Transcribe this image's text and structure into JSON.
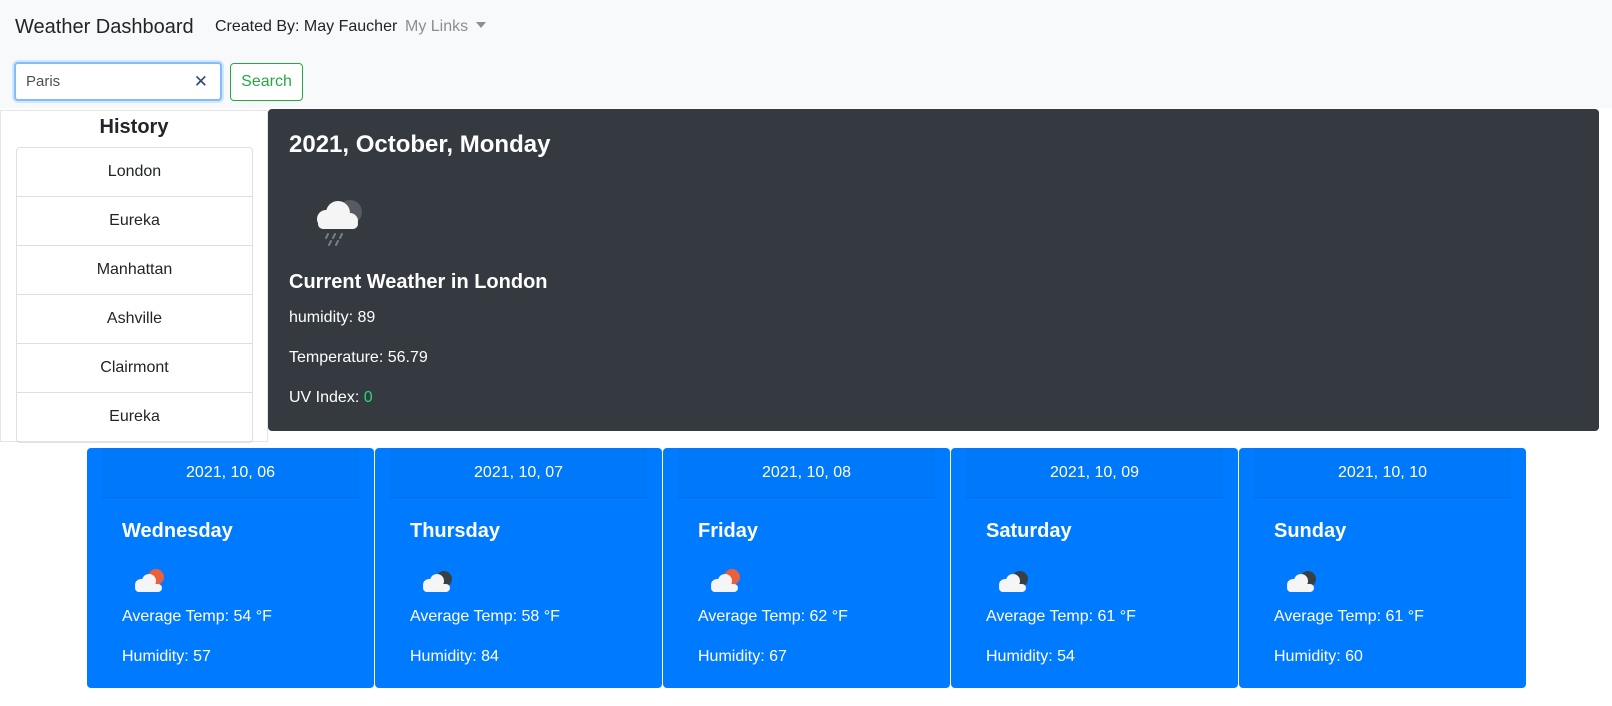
{
  "navbar": {
    "brand": "Weather Dashboard",
    "created_by": "Created By: May Faucher",
    "my_links": "My Links"
  },
  "search": {
    "value": "Paris",
    "button_label": "Search"
  },
  "history": {
    "title": "History",
    "items": [
      "London",
      "Eureka",
      "Manhattan",
      "Ashville",
      "Clairmont",
      "Eureka"
    ]
  },
  "current": {
    "date": "2021, October, Monday",
    "icon": "cloud-rain-icon",
    "heading": "Current Weather in London",
    "humidity_label": "humidity: ",
    "humidity": "89",
    "temperature_label": "Temperature: ",
    "temperature": "56.79",
    "uv_label": "UV Index: ",
    "uv": "0",
    "uv_color": "#28d77a"
  },
  "forecast": [
    {
      "date": "2021, 10, 06",
      "day": "Wednesday",
      "icon": "partly-sunny-icon",
      "temp": "Average Temp: 54 °F",
      "humidity": "Humidity: 57"
    },
    {
      "date": "2021, 10, 07",
      "day": "Thursday",
      "icon": "cloudy-icon",
      "temp": "Average Temp: 58 °F",
      "humidity": "Humidity: 84"
    },
    {
      "date": "2021, 10, 08",
      "day": "Friday",
      "icon": "partly-sunny-icon",
      "temp": "Average Temp: 62 °F",
      "humidity": "Humidity: 67"
    },
    {
      "date": "2021, 10, 09",
      "day": "Saturday",
      "icon": "cloudy-icon",
      "temp": "Average Temp: 61 °F",
      "humidity": "Humidity: 54"
    },
    {
      "date": "2021, 10, 10",
      "day": "Sunday",
      "icon": "cloudy-icon",
      "temp": "Average Temp: 61 °F",
      "humidity": "Humidity: 60"
    }
  ],
  "colors": {
    "navbar_bg": "#f8f9fa",
    "current_bg": "#343a40",
    "forecast_bg": "#007bff",
    "search_btn": "#28a745"
  }
}
